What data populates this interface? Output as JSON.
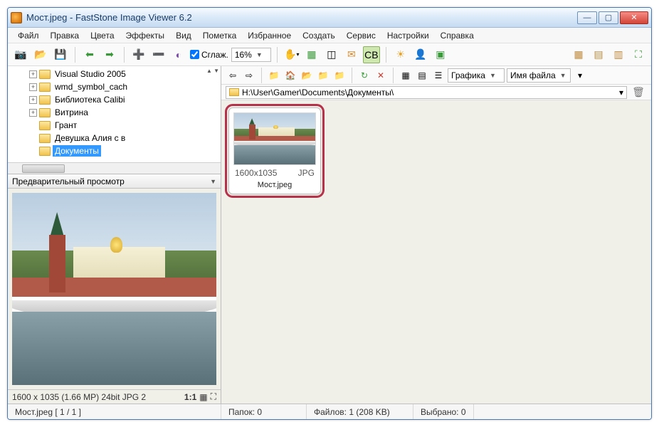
{
  "window": {
    "title": "Мост.jpeg  -  FastStone Image Viewer 6.2"
  },
  "menu": {
    "file": "Файл",
    "edit": "Правка",
    "colors": "Цвета",
    "effects": "Эффекты",
    "view": "Вид",
    "tag": "Пометка",
    "favorites": "Избранное",
    "create": "Создать",
    "service": "Сервис",
    "settings": "Настройки",
    "help": "Справка"
  },
  "toolbar": {
    "smooth_label": "Сглаж.",
    "zoom_value": "16%",
    "view_combo": "Графика",
    "sort_combo": "Имя файла"
  },
  "tree": {
    "items": [
      {
        "label": "Visual Studio 2005",
        "exp": "+"
      },
      {
        "label": "wmd_symbol_cach",
        "exp": "+"
      },
      {
        "label": "Библиотека Calibi",
        "exp": "+"
      },
      {
        "label": "Витрина",
        "exp": "+"
      },
      {
        "label": "Грант",
        "exp": ""
      },
      {
        "label": "Девушка Алия с в",
        "exp": ""
      },
      {
        "label": "Документы",
        "exp": "",
        "selected": true
      }
    ],
    "updown": "▲\n▼"
  },
  "preview": {
    "header": "Предварительный просмотр",
    "status": "1600 x 1035 (1.66 MP)  24bit  JPG  2",
    "ratio": "1:1"
  },
  "path": {
    "value": "H:\\User\\Gamer\\Documents\\Документы\\"
  },
  "thumb": {
    "dims": "1600x1035",
    "fmt": "JPG",
    "name": "Мост.jpeg"
  },
  "status": {
    "left": "Мост.jpeg [ 1 / 1 ]",
    "folders": "Папок: 0",
    "files": "Файлов: 1 (208 KB)",
    "selected": "Выбрано: 0"
  }
}
